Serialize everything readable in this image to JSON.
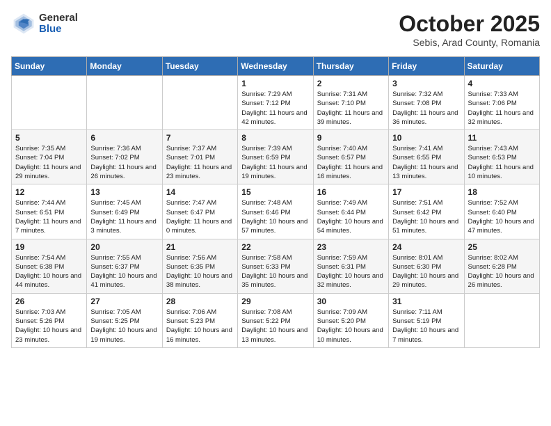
{
  "header": {
    "logo_general": "General",
    "logo_blue": "Blue",
    "month_title": "October 2025",
    "location": "Sebis, Arad County, Romania"
  },
  "weekdays": [
    "Sunday",
    "Monday",
    "Tuesday",
    "Wednesday",
    "Thursday",
    "Friday",
    "Saturday"
  ],
  "weeks": [
    [
      {
        "day": "",
        "info": ""
      },
      {
        "day": "",
        "info": ""
      },
      {
        "day": "",
        "info": ""
      },
      {
        "day": "1",
        "info": "Sunrise: 7:29 AM\nSunset: 7:12 PM\nDaylight: 11 hours\nand 42 minutes."
      },
      {
        "day": "2",
        "info": "Sunrise: 7:31 AM\nSunset: 7:10 PM\nDaylight: 11 hours\nand 39 minutes."
      },
      {
        "day": "3",
        "info": "Sunrise: 7:32 AM\nSunset: 7:08 PM\nDaylight: 11 hours\nand 36 minutes."
      },
      {
        "day": "4",
        "info": "Sunrise: 7:33 AM\nSunset: 7:06 PM\nDaylight: 11 hours\nand 32 minutes."
      }
    ],
    [
      {
        "day": "5",
        "info": "Sunrise: 7:35 AM\nSunset: 7:04 PM\nDaylight: 11 hours\nand 29 minutes."
      },
      {
        "day": "6",
        "info": "Sunrise: 7:36 AM\nSunset: 7:02 PM\nDaylight: 11 hours\nand 26 minutes."
      },
      {
        "day": "7",
        "info": "Sunrise: 7:37 AM\nSunset: 7:01 PM\nDaylight: 11 hours\nand 23 minutes."
      },
      {
        "day": "8",
        "info": "Sunrise: 7:39 AM\nSunset: 6:59 PM\nDaylight: 11 hours\nand 19 minutes."
      },
      {
        "day": "9",
        "info": "Sunrise: 7:40 AM\nSunset: 6:57 PM\nDaylight: 11 hours\nand 16 minutes."
      },
      {
        "day": "10",
        "info": "Sunrise: 7:41 AM\nSunset: 6:55 PM\nDaylight: 11 hours\nand 13 minutes."
      },
      {
        "day": "11",
        "info": "Sunrise: 7:43 AM\nSunset: 6:53 PM\nDaylight: 11 hours\nand 10 minutes."
      }
    ],
    [
      {
        "day": "12",
        "info": "Sunrise: 7:44 AM\nSunset: 6:51 PM\nDaylight: 11 hours\nand 7 minutes."
      },
      {
        "day": "13",
        "info": "Sunrise: 7:45 AM\nSunset: 6:49 PM\nDaylight: 11 hours\nand 3 minutes."
      },
      {
        "day": "14",
        "info": "Sunrise: 7:47 AM\nSunset: 6:47 PM\nDaylight: 11 hours\nand 0 minutes."
      },
      {
        "day": "15",
        "info": "Sunrise: 7:48 AM\nSunset: 6:46 PM\nDaylight: 10 hours\nand 57 minutes."
      },
      {
        "day": "16",
        "info": "Sunrise: 7:49 AM\nSunset: 6:44 PM\nDaylight: 10 hours\nand 54 minutes."
      },
      {
        "day": "17",
        "info": "Sunrise: 7:51 AM\nSunset: 6:42 PM\nDaylight: 10 hours\nand 51 minutes."
      },
      {
        "day": "18",
        "info": "Sunrise: 7:52 AM\nSunset: 6:40 PM\nDaylight: 10 hours\nand 47 minutes."
      }
    ],
    [
      {
        "day": "19",
        "info": "Sunrise: 7:54 AM\nSunset: 6:38 PM\nDaylight: 10 hours\nand 44 minutes."
      },
      {
        "day": "20",
        "info": "Sunrise: 7:55 AM\nSunset: 6:37 PM\nDaylight: 10 hours\nand 41 minutes."
      },
      {
        "day": "21",
        "info": "Sunrise: 7:56 AM\nSunset: 6:35 PM\nDaylight: 10 hours\nand 38 minutes."
      },
      {
        "day": "22",
        "info": "Sunrise: 7:58 AM\nSunset: 6:33 PM\nDaylight: 10 hours\nand 35 minutes."
      },
      {
        "day": "23",
        "info": "Sunrise: 7:59 AM\nSunset: 6:31 PM\nDaylight: 10 hours\nand 32 minutes."
      },
      {
        "day": "24",
        "info": "Sunrise: 8:01 AM\nSunset: 6:30 PM\nDaylight: 10 hours\nand 29 minutes."
      },
      {
        "day": "25",
        "info": "Sunrise: 8:02 AM\nSunset: 6:28 PM\nDaylight: 10 hours\nand 26 minutes."
      }
    ],
    [
      {
        "day": "26",
        "info": "Sunrise: 7:03 AM\nSunset: 5:26 PM\nDaylight: 10 hours\nand 23 minutes."
      },
      {
        "day": "27",
        "info": "Sunrise: 7:05 AM\nSunset: 5:25 PM\nDaylight: 10 hours\nand 19 minutes."
      },
      {
        "day": "28",
        "info": "Sunrise: 7:06 AM\nSunset: 5:23 PM\nDaylight: 10 hours\nand 16 minutes."
      },
      {
        "day": "29",
        "info": "Sunrise: 7:08 AM\nSunset: 5:22 PM\nDaylight: 10 hours\nand 13 minutes."
      },
      {
        "day": "30",
        "info": "Sunrise: 7:09 AM\nSunset: 5:20 PM\nDaylight: 10 hours\nand 10 minutes."
      },
      {
        "day": "31",
        "info": "Sunrise: 7:11 AM\nSunset: 5:19 PM\nDaylight: 10 hours\nand 7 minutes."
      },
      {
        "day": "",
        "info": ""
      }
    ]
  ]
}
